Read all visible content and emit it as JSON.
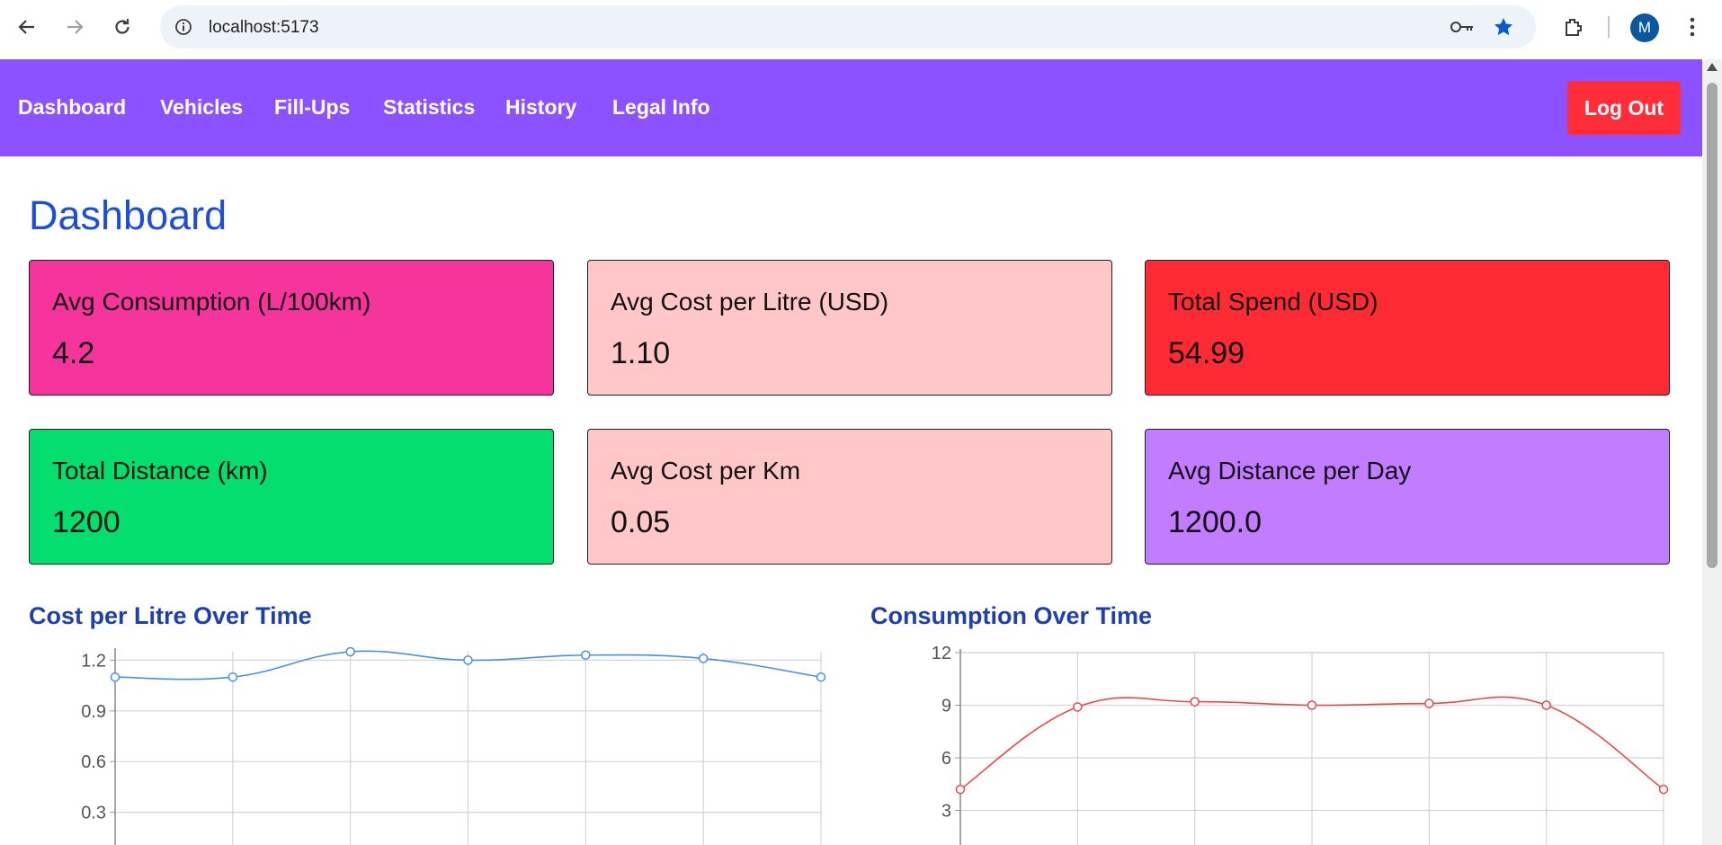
{
  "browser": {
    "url": "localhost:5173",
    "profile_initial": "M"
  },
  "navbar": {
    "links": [
      "Dashboard",
      "Vehicles",
      "Fill-Ups",
      "Statistics",
      "History",
      "Legal Info"
    ],
    "logout_label": "Log Out"
  },
  "page": {
    "title": "Dashboard"
  },
  "cards": [
    {
      "label": "Avg Consumption (L/100km)",
      "value": "4.2",
      "color": "#f5359c"
    },
    {
      "label": "Avg Cost per Litre (USD)",
      "value": "1.10",
      "color": "#ffc7c8"
    },
    {
      "label": "Total Spend (USD)",
      "value": "54.99",
      "color": "#fe2b34"
    },
    {
      "label": "Total Distance (km)",
      "value": "1200",
      "color": "#04de6f"
    },
    {
      "label": "Avg Cost per Km",
      "value": "0.05",
      "color": "#ffc7c8"
    },
    {
      "label": "Avg Distance per Day",
      "value": "1200.0",
      "color": "#c27cff"
    }
  ],
  "chart_data": [
    {
      "type": "line",
      "title": "Cost per Litre Over Time",
      "y_ticks": [
        "1.2",
        "0.9",
        "0.6",
        "0.3"
      ],
      "ylim": [
        0,
        1.25
      ],
      "values": [
        1.1,
        1.1,
        1.25,
        1.2,
        1.23,
        1.21,
        1.1
      ],
      "color": "#4a8fe7",
      "grid": true
    },
    {
      "type": "line",
      "title": "Consumption Over Time",
      "y_ticks": [
        "12",
        "9",
        "6",
        "3"
      ],
      "ylim": [
        0,
        12
      ],
      "values": [
        4.2,
        8.9,
        9.2,
        9.0,
        9.1,
        9.0,
        4.2
      ],
      "color": "#e8474c",
      "grid": true
    }
  ]
}
